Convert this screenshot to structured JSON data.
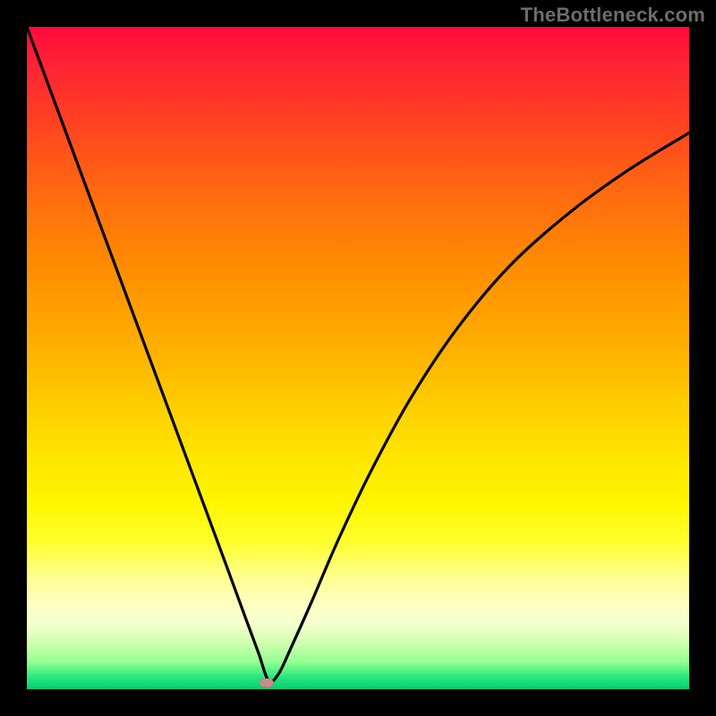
{
  "watermark": "TheBottleneck.com",
  "colors": {
    "frame": "#000000",
    "curve": "#000000",
    "marker": "#cc8a8a",
    "gradient_top": "#ff0a3a",
    "gradient_bottom": "#00d070"
  },
  "chart_data": {
    "type": "line",
    "title": "",
    "xlabel": "",
    "ylabel": "",
    "xlim": [
      0,
      100
    ],
    "ylim": [
      0,
      100
    ],
    "grid": false,
    "legend": false,
    "annotations": [
      "TheBottleneck.com"
    ],
    "series": [
      {
        "name": "bottleneck-curve",
        "x": [
          0,
          5,
          10,
          15,
          20,
          25,
          30,
          33,
          35,
          36.5,
          38,
          40,
          43,
          47,
          52,
          58,
          65,
          73,
          82,
          91,
          100
        ],
        "y": [
          100,
          86.5,
          73,
          59.5,
          46,
          32.5,
          19,
          10.8,
          5.4,
          1.3,
          2.3,
          6.5,
          13.2,
          22.5,
          33,
          44,
          54.5,
          64,
          72,
          78.5,
          84
        ]
      }
    ],
    "marker": {
      "x": 36.2,
      "y": 0.9
    },
    "color_scale_meaning": "vertical position encodes bottleneck: top=red (high bottleneck), bottom=green (low bottleneck)"
  }
}
